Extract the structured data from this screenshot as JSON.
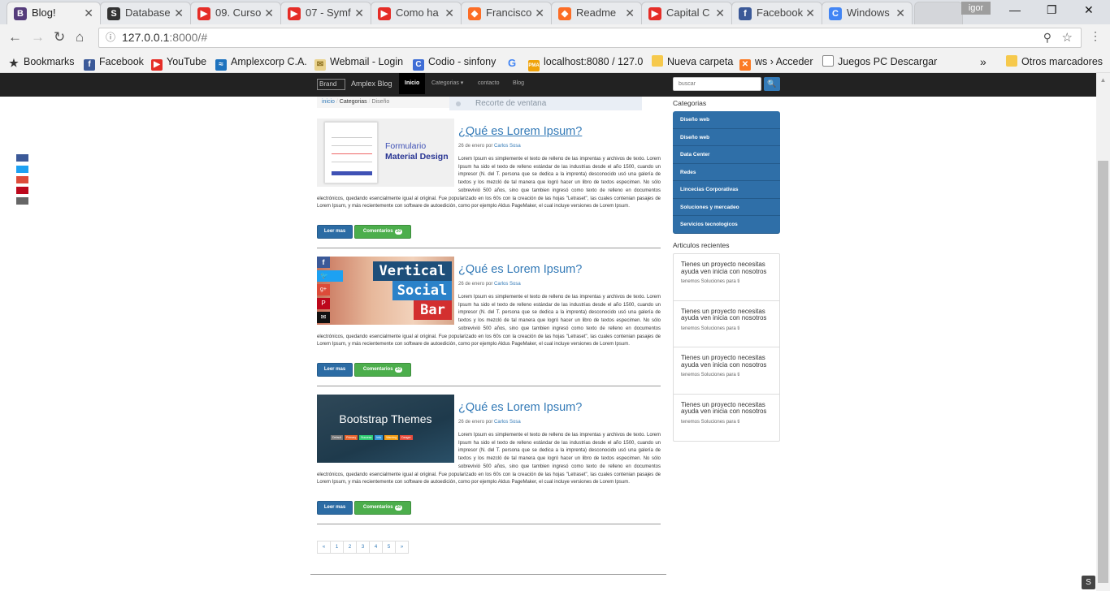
{
  "tabs": [
    {
      "title": "Blog!",
      "fav": "B",
      "color": "#563d7c"
    },
    {
      "title": "Database",
      "fav": "S",
      "color": "#333333"
    },
    {
      "title": "09. Curso",
      "fav": "▶",
      "color": "#e52d27"
    },
    {
      "title": "07 - Symf",
      "fav": "▶",
      "color": "#e52d27"
    },
    {
      "title": "Como ha",
      "fav": "▶",
      "color": "#e52d27"
    },
    {
      "title": "Francisco",
      "fav": "◆",
      "color": "#fc6d26"
    },
    {
      "title": "Readme",
      "fav": "◆",
      "color": "#fc6d26"
    },
    {
      "title": "Capital C",
      "fav": "▶",
      "color": "#e52d27"
    },
    {
      "title": "Facebook",
      "fav": "f",
      "color": "#3b5998"
    },
    {
      "title": "Windows",
      "fav": "C",
      "color": "#4285f4"
    }
  ],
  "profile": "igor",
  "url": {
    "host": "127.0.0.1",
    "rest": ":8000/#"
  },
  "bookmarks": [
    {
      "label": "Bookmarks",
      "icon": "star-icon",
      "color": "#333333"
    },
    {
      "label": "Facebook",
      "icon": "facebook-icon",
      "color": "#3b5998"
    },
    {
      "label": "YouTube",
      "icon": "youtube-icon",
      "color": "#e52d27"
    },
    {
      "label": "Amplexcorp C.A.",
      "icon": "wifi-icon",
      "color": "#1e73be"
    },
    {
      "label": "Webmail - Login",
      "icon": "mail-icon",
      "color": "#c9a227"
    },
    {
      "label": "Codio - sinfony",
      "icon": "codio-icon",
      "color": "#3e6dd6"
    },
    {
      "label": "",
      "icon": "google-icon",
      "color": "#4285f4"
    },
    {
      "label": "localhost:8080 / 127.0",
      "icon": "pma-icon",
      "color": "#f0a30a"
    },
    {
      "label": "Nueva carpeta",
      "icon": "folder-icon",
      "color": "#f6c94c"
    },
    {
      "label": "ws › Acceder",
      "icon": "xampp-icon",
      "color": "#fb7a24"
    },
    {
      "label": "Juegos PC Descargar",
      "icon": "page-icon",
      "color": "#ffffff"
    }
  ],
  "bookmarks_more": "»",
  "other_bookmarks": "Otros marcadores",
  "navbar": {
    "brand_alt": "Brand",
    "blog_name": "Amplex Blog",
    "items": [
      "Inicio",
      "Categorias ▾",
      "contacto",
      "Blog"
    ],
    "search_placeholder": "buscar",
    "search_button": "🔍"
  },
  "breadcrumb": [
    "inicio",
    "Categorias",
    "Diseño"
  ],
  "screenshot_tool": "Recorte de ventana",
  "posts": [
    {
      "title": "¿Qué es Lorem Ipsum?",
      "date": "26 de enero por ",
      "author": "Carlos Sosa",
      "thumb_title_1": "Formulario",
      "thumb_title_2": "Material Design",
      "body": "Lorem Ipsum es simplemente el texto de relleno de las imprentas y archivos de texto. Lorem Ipsum ha sido el texto de relleno estándar de las industrias desde el año 1500, cuando un impresor (N. del T. persona que se dedica a la imprenta) desconocido usó una galería de textos y los mezcló de tal manera que logró hacer un libro de textos especimen. No sólo sobrevivió 500 años, sino que tambien ingresó como texto de relleno en documentos electrónicos, quedando esencialmente igual al original. Fue popularizado en los 60s con la creación de las hojas \"Letraset\", las cuales contenian pasajes de Lorem Ipsum, y más recientemente con software de autoedición, como por ejemplo Aldus PageMaker, el cual incluye versiones de Lorem Ipsum.",
      "read_more": "Leer mas",
      "comments": "Comentarios",
      "comments_count": "20"
    },
    {
      "title": "¿Qué es Lorem Ipsum?",
      "date": "26 de enero por ",
      "author": "Carlos Sosa",
      "thumb_title_1": "Vertical",
      "thumb_title_2": "Social",
      "thumb_title_3": "Bar",
      "body": "Lorem Ipsum es simplemente el texto de relleno de las imprentas y archivos de texto. Lorem Ipsum ha sido el texto de relleno estándar de las industrias desde el año 1500, cuando un impresor (N. del T. persona que se dedica a la imprenta) desconocido usó una galería de textos y los mezcló de tal manera que logró hacer un libro de textos especimen. No sólo sobrevivió 500 años, sino que tambien ingresó como texto de relleno en documentos electrónicos, quedando esencialmente igual al original. Fue popularizado en los 60s con la creación de las hojas \"Letraset\", las cuales contenian pasajes de Lorem Ipsum, y más recientemente con software de autoedición, como por ejemplo Aldus PageMaker, el cual incluye versiones de Lorem Ipsum.",
      "read_more": "Leer mas",
      "comments": "Comentarios",
      "comments_count": "20"
    },
    {
      "title": "¿Qué es Lorem Ipsum?",
      "date": "26 de enero por ",
      "author": "Carlos Sosa",
      "thumb_title_1": "Bootstrap Themes",
      "thumb_labels": [
        "Default",
        "Primary",
        "Success",
        "Info",
        "Warning",
        "Danger"
      ],
      "body": "Lorem Ipsum es simplemente el texto de relleno de las imprentas y archivos de texto. Lorem Ipsum ha sido el texto de relleno estándar de las industrias desde el año 1500, cuando un impresor (N. del T. persona que se dedica a la imprenta) desconocido usó una galería de textos y los mezcló de tal manera que logró hacer un libro de textos especimen. No sólo sobrevivió 500 años, sino que tambien ingresó como texto de relleno en documentos electrónicos, quedando esencialmente igual al original. Fue popularizado en los 60s con la creación de las hojas \"Letraset\", las cuales contenian pasajes de Lorem Ipsum, y más recientemente con software de autoedición, como por ejemplo Aldus PageMaker, el cual incluye versiones de Lorem Ipsum.",
      "read_more": "Leer mas",
      "comments": "Comentarios",
      "comments_count": "20"
    }
  ],
  "pagination": [
    "«",
    "1",
    "2",
    "3",
    "4",
    "5",
    "»"
  ],
  "sidebar": {
    "categories_title": "Categorias",
    "categories": [
      "Diseño web",
      "Diseño web",
      "Data Center",
      "Redes",
      "Lincecias Corporativas",
      "Soluciones y mercadeo",
      "Servicios tecnologicos"
    ],
    "recent_title": "Articulos recientes",
    "recent": [
      {
        "title": "Tienes un proyecto necesitas ayuda ven inicia con nosotros",
        "sub": "tenemos Soluciones para ti"
      },
      {
        "title": "Tienes un proyecto necesitas ayuda ven inicia con nosotros",
        "sub": "tenemos Soluciones para ti"
      },
      {
        "title": "Tienes un proyecto necesitas ayuda ven inicia con nosotros",
        "sub": "tenemos Soluciones para ti"
      },
      {
        "title": "Tienes un proyecto necesitas ayuda ven inicia con nosotros",
        "sub": "tenemos Soluciones para ti"
      }
    ]
  },
  "social_colors": [
    "#3b5998",
    "#1da1f2",
    "#dd4b39",
    "#bd081c",
    "#666666"
  ]
}
